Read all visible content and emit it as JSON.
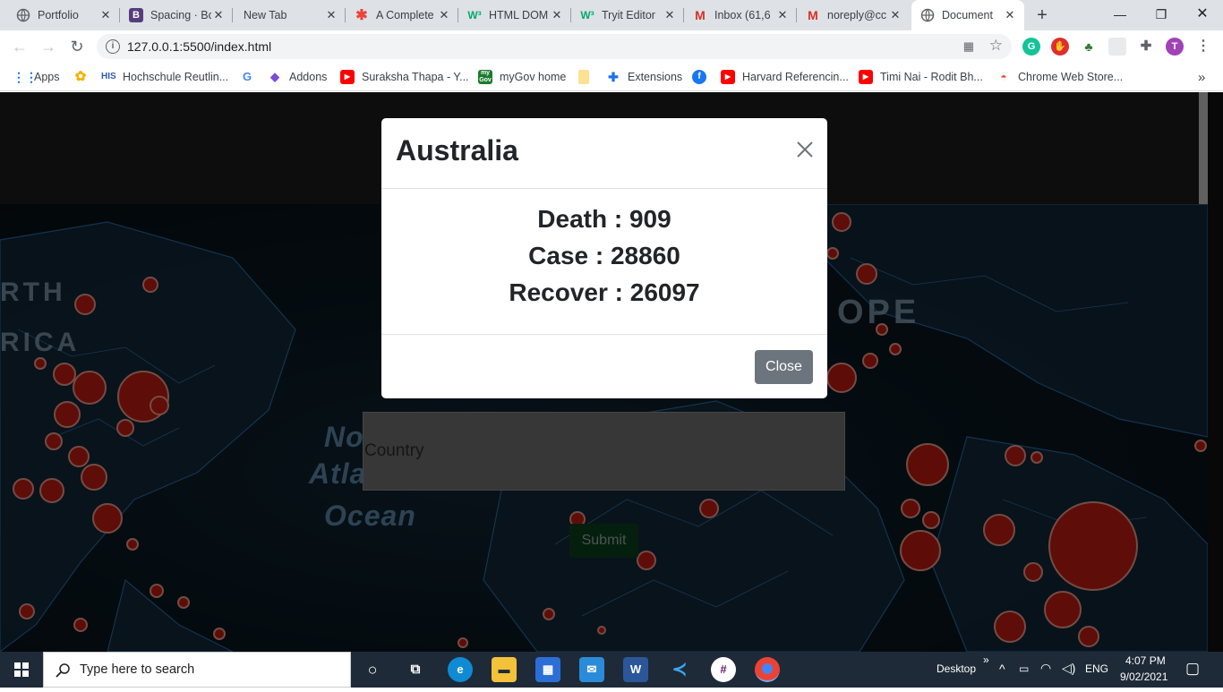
{
  "browser": {
    "tabs": [
      {
        "title": "Portfolio",
        "icon": "globe-icon"
      },
      {
        "title": "Spacing · Bo",
        "icon": "bootstrap-icon"
      },
      {
        "title": "New Tab",
        "icon": ""
      },
      {
        "title": "A Complete",
        "icon": "asterisk-icon"
      },
      {
        "title": "HTML DOM",
        "icon": "w3schools-icon"
      },
      {
        "title": "Tryit Editor",
        "icon": "w3schools-icon"
      },
      {
        "title": "Inbox (61,6",
        "icon": "gmail-icon"
      },
      {
        "title": "noreply@cc",
        "icon": "gmail-icon"
      },
      {
        "title": "Document",
        "icon": "globe-icon"
      }
    ],
    "url": "127.0.0.1:5500/index.html",
    "bookmarks": [
      {
        "label": "Apps",
        "icon": "apps-grid-icon"
      },
      {
        "label": "",
        "icon": "photos-icon"
      },
      {
        "label": "Hochschule Reutlin...",
        "icon": "his-icon"
      },
      {
        "label": "",
        "icon": "google-icon"
      },
      {
        "label": "Addons",
        "icon": "addons-icon"
      },
      {
        "label": "Suraksha Thapa - Y...",
        "icon": "youtube-icon"
      },
      {
        "label": "myGov home",
        "icon": "mygov-icon"
      },
      {
        "label": "",
        "icon": "folder-icon"
      },
      {
        "label": "Extensions",
        "icon": "puzzle-icon"
      },
      {
        "label": "",
        "icon": "facebook-icon"
      },
      {
        "label": "Harvard Referencin...",
        "icon": "youtube-icon"
      },
      {
        "label": "Timi Nai - Rodit Bh...",
        "icon": "youtube-icon"
      },
      {
        "label": "Chrome Web Store...",
        "icon": "webstore-icon"
      }
    ],
    "bookmarks_overflow": "»",
    "profile_initial": "T"
  },
  "page": {
    "map_labels": {
      "north": "RTH",
      "america": "RICA",
      "europe": "OPE",
      "ocean_1": "No",
      "ocean_2": "Atla",
      "ocean_3": "Ocean"
    },
    "country_placeholder": "Country",
    "submit_label": "Submit"
  },
  "modal": {
    "title": "Australia",
    "death_line": "Death : 909",
    "case_line": "Case : 28860",
    "recover_line": "Recover : 26097",
    "close_label": "Close"
  },
  "stats": {
    "country": "Australia",
    "death": 909,
    "case": 28860,
    "recover": 26097
  },
  "taskbar": {
    "search_placeholder": "Type here to search",
    "desktop_label": "Desktop",
    "overflow": "»",
    "language": "ENG",
    "time": "4:07 PM",
    "date": "9/02/2021"
  },
  "colors": {
    "accent_red": "#c61a0f",
    "submit_green": "#0b3f1f",
    "close_button": "#6c757d"
  }
}
